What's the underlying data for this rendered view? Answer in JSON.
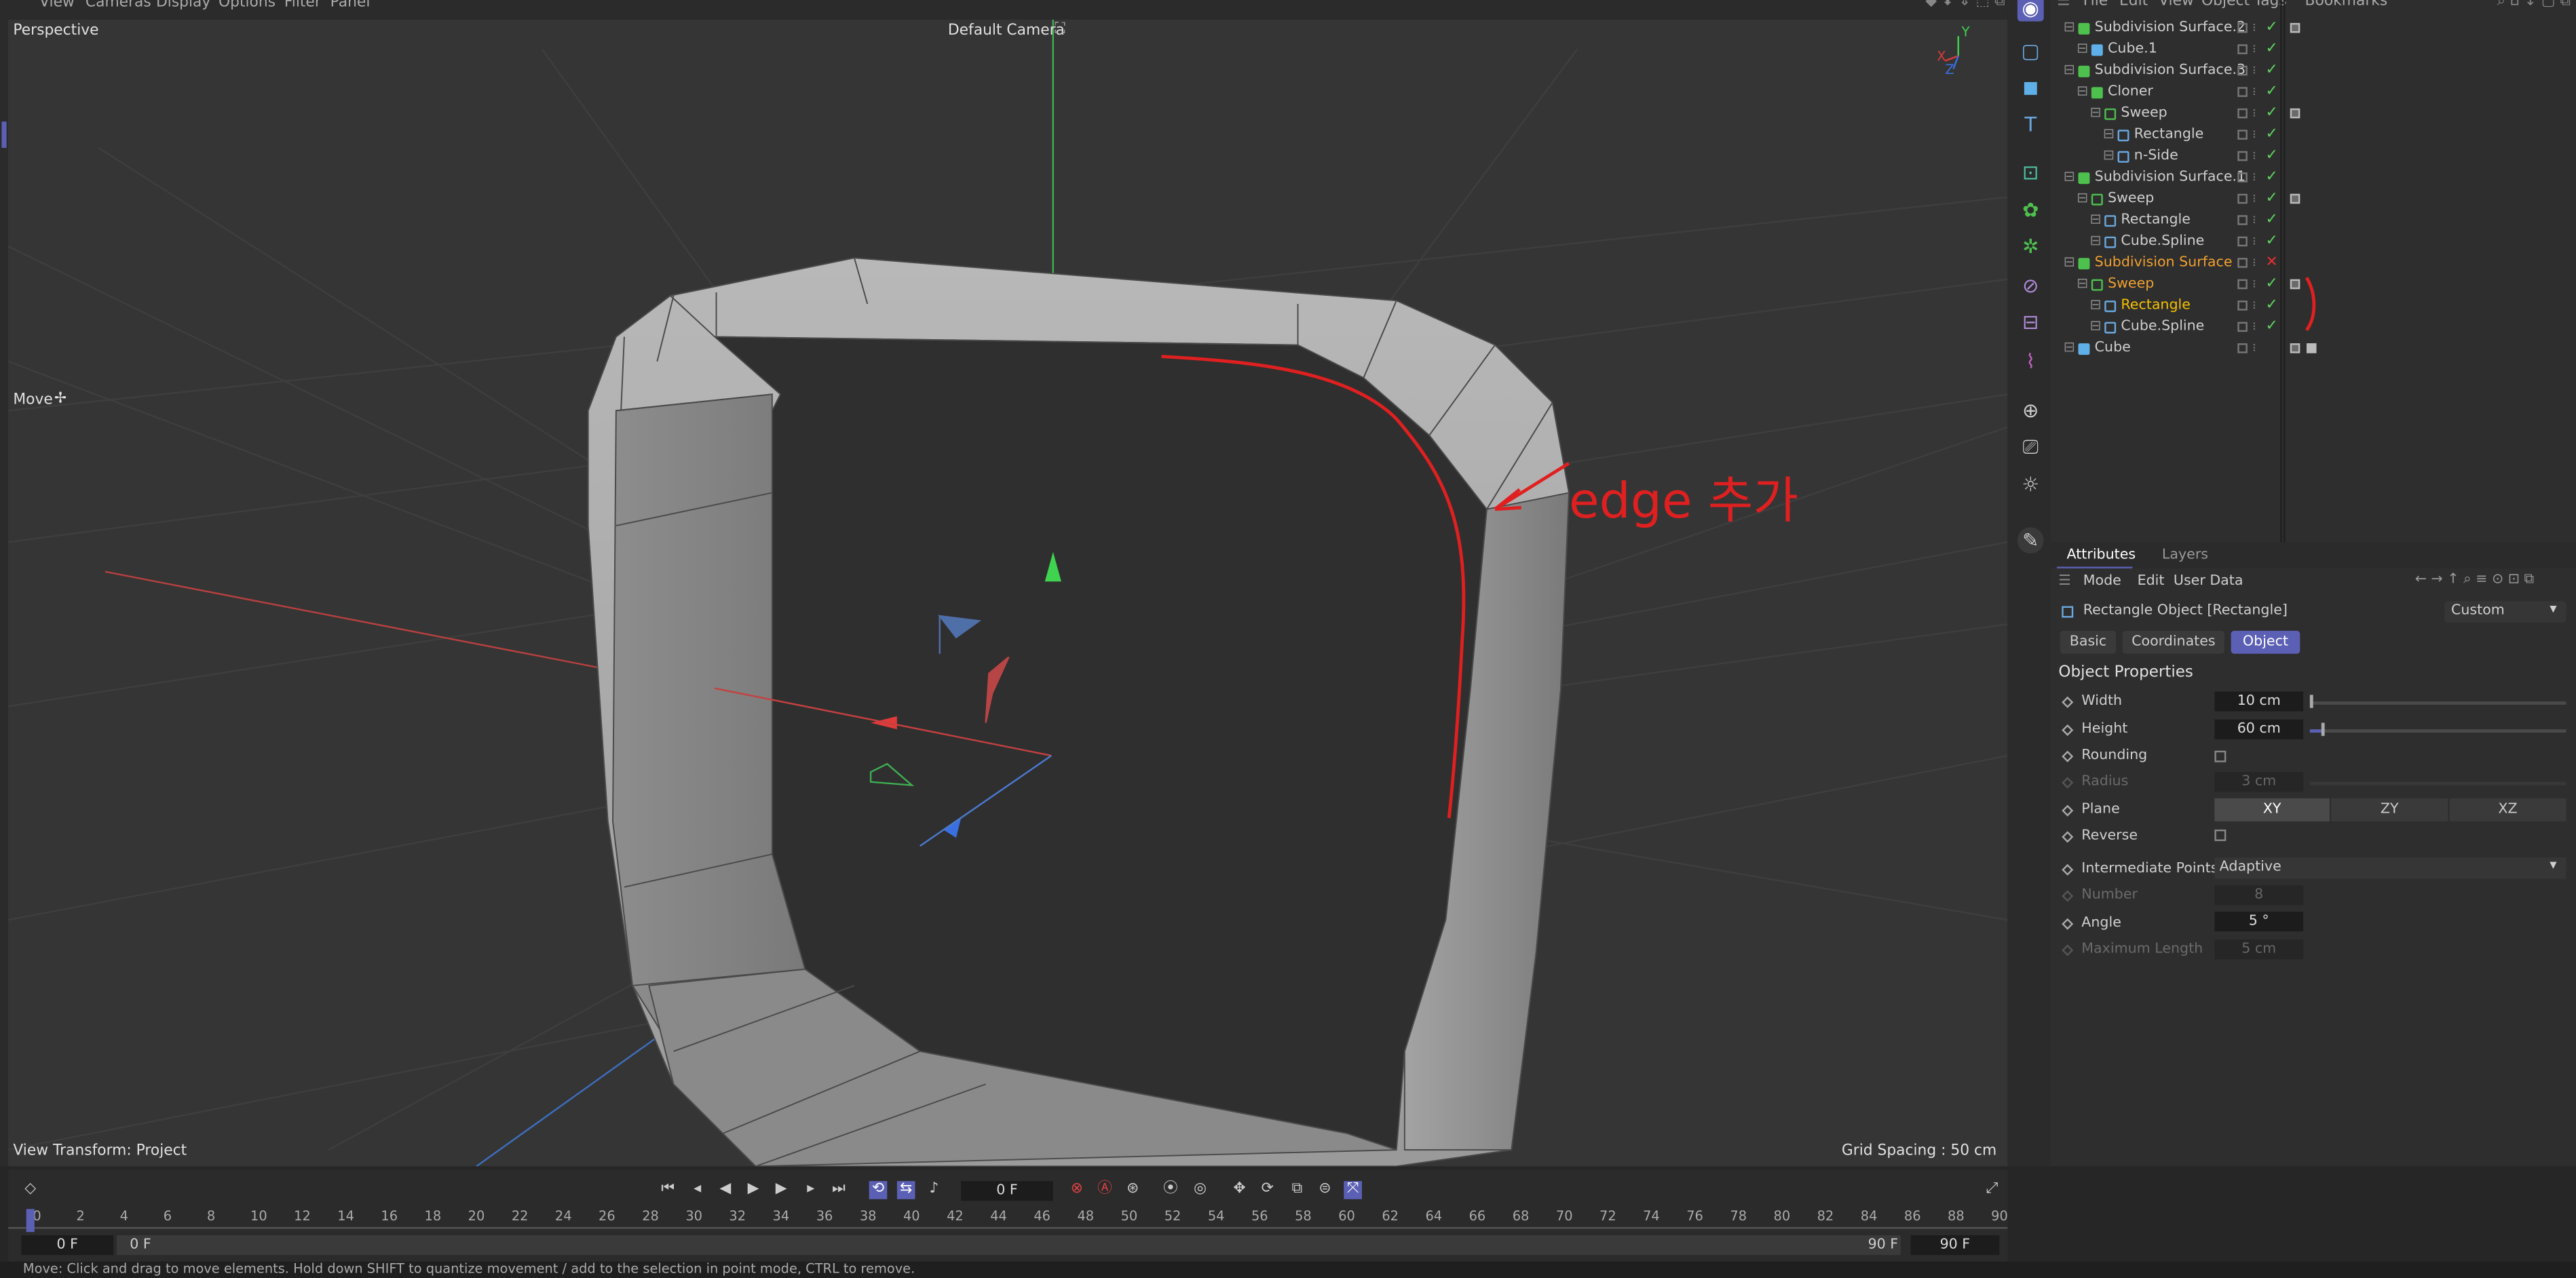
{
  "viewport_menu": [
    "View",
    "Cameras",
    "Display",
    "Options",
    "Filter",
    "Panel"
  ],
  "viewport": {
    "projection": "Perspective",
    "camera": "Default Camera",
    "tool": "Move",
    "view_transform": "View Transform: Project",
    "grid_spacing": "Grid Spacing : 50 cm",
    "axis_x": "X",
    "axis_y": "Y",
    "axis_z": "Z",
    "annotation": "edge 추가"
  },
  "object_manager": {
    "menu": [
      "File",
      "Edit",
      "View",
      "Object",
      "Tags",
      "Bookmarks"
    ],
    "rows": [
      {
        "name": "Subdivision Surface.2",
        "depth": 0,
        "icon": "subdivision",
        "state": "check"
      },
      {
        "name": "Cube.1",
        "depth": 1,
        "icon": "cube",
        "state": "check"
      },
      {
        "name": "Subdivision Surface.3",
        "depth": 0,
        "icon": "subdivision",
        "state": "check"
      },
      {
        "name": "Cloner",
        "depth": 1,
        "icon": "cloner",
        "state": "check"
      },
      {
        "name": "Sweep",
        "depth": 2,
        "icon": "sweep",
        "state": "check"
      },
      {
        "name": "Rectangle",
        "depth": 3,
        "icon": "rectangle",
        "state": "check"
      },
      {
        "name": "n-Side",
        "depth": 3,
        "icon": "spline",
        "state": "check"
      },
      {
        "name": "Subdivision Surface.1",
        "depth": 0,
        "icon": "subdivision",
        "state": "check"
      },
      {
        "name": "Sweep",
        "depth": 1,
        "icon": "sweep",
        "state": "check"
      },
      {
        "name": "Rectangle",
        "depth": 2,
        "icon": "rectangle",
        "state": "check"
      },
      {
        "name": "Cube.Spline",
        "depth": 2,
        "icon": "spline",
        "state": "check"
      },
      {
        "name": "Subdivision Surface",
        "depth": 0,
        "icon": "subdivision",
        "state": "cross",
        "highlight": "orange"
      },
      {
        "name": "Sweep",
        "depth": 1,
        "icon": "sweep",
        "state": "check",
        "highlight": "orange"
      },
      {
        "name": "Rectangle",
        "depth": 2,
        "icon": "rectangle",
        "state": "check",
        "highlight": "yellow"
      },
      {
        "name": "Cube.Spline",
        "depth": 2,
        "icon": "spline",
        "state": "check"
      },
      {
        "name": "Cube",
        "depth": 0,
        "icon": "cube",
        "state": "none"
      }
    ]
  },
  "attributes": {
    "tabs": [
      "Attributes",
      "Layers"
    ],
    "menu": [
      "Mode",
      "Edit",
      "User Data"
    ],
    "object_title": "Rectangle Object [Rectangle]",
    "layout": "Custom",
    "subtabs": [
      "Basic",
      "Coordinates",
      "Object"
    ],
    "active_subtab": "Object",
    "section": "Object Properties",
    "width_label": "Width",
    "width_value": "10 cm",
    "height_label": "Height",
    "height_value": "60 cm",
    "rounding_label": "Rounding",
    "radius_label": "Radius",
    "radius_value": "3 cm",
    "plane_label": "Plane",
    "plane_options": [
      "XY",
      "ZY",
      "XZ"
    ],
    "reverse_label": "Reverse",
    "intermediate_label": "Intermediate Points",
    "intermediate_value": "Adaptive",
    "number_label": "Number",
    "number_value": "8",
    "angle_label": "Angle",
    "angle_value": "5 °",
    "maxlen_label": "Maximum Length",
    "maxlen_value": "5 cm"
  },
  "timeline": {
    "current_frame": "0 F",
    "ticks": [
      "0",
      "2",
      "4",
      "6",
      "8",
      "10",
      "12",
      "14",
      "16",
      "18",
      "20",
      "22",
      "24",
      "26",
      "28",
      "30",
      "32",
      "34",
      "36",
      "38",
      "40",
      "42",
      "44",
      "46",
      "48",
      "50",
      "52",
      "54",
      "56",
      "58",
      "60",
      "62",
      "64",
      "66",
      "68",
      "70",
      "72",
      "74",
      "76",
      "78",
      "80",
      "82",
      "84",
      "86",
      "88",
      "90"
    ],
    "start": "0 F",
    "range_start": "0 F",
    "range_end": "90 F",
    "end": "90 F"
  },
  "status_text": "Move: Click and drag to move elements. Hold down SHIFT to quantize movement / add to the selection in point mode, CTRL to remove.",
  "colors": {
    "accent": "#5c60b5",
    "orange": "#f0a030",
    "yellow": "#f5c000",
    "check": "#5fd35f",
    "cross": "#e53030"
  }
}
